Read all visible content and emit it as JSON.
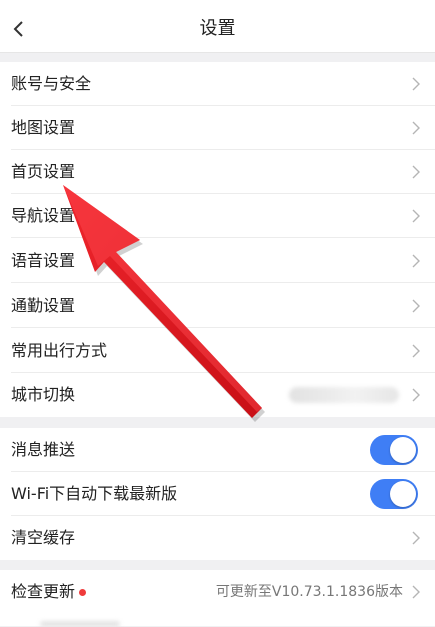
{
  "header": {
    "title": "设置"
  },
  "menu": {
    "account_security": "账号与安全",
    "map_settings": "地图设置",
    "home_settings": "首页设置",
    "navigation_settings": "导航设置",
    "voice_settings": "语音设置",
    "commute_settings": "通勤设置",
    "frequent_travel_mode": "常用出行方式",
    "city_switch": "城市切换"
  },
  "toggles": {
    "message_push": {
      "label": "消息推送",
      "enabled": true
    },
    "wifi_auto_download": {
      "label": "Wi-Fi下自动下载最新版",
      "enabled": true
    }
  },
  "cache": {
    "clear_label": "清空缓存"
  },
  "update": {
    "label": "检查更新",
    "status": "可更新至V10.73.1.1836版本",
    "badge_color": "#ef3b3b"
  },
  "colors": {
    "toggle_on": "#3f7ef5",
    "annotation_arrow": "#e8141c",
    "background": "#f0f0f2"
  },
  "icons": {
    "back": "chevron-left-icon",
    "row_chevron": "chevron-right-icon",
    "annotation": "red-pointer-arrow"
  }
}
